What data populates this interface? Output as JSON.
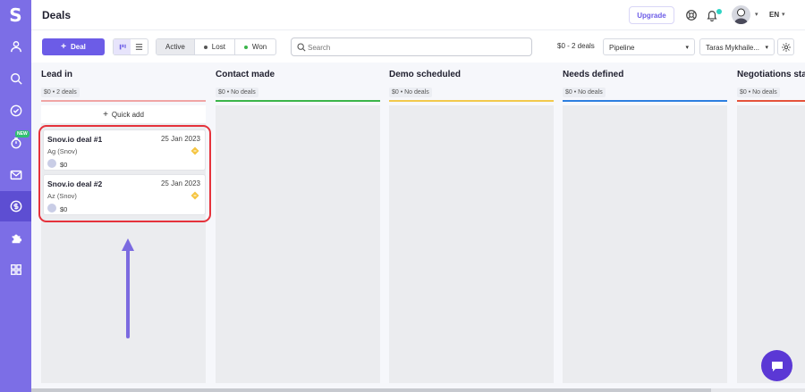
{
  "app": {
    "logo": "S",
    "page_title": "Deals"
  },
  "sidebar": {
    "items": [
      {
        "icon": "user-icon"
      },
      {
        "icon": "search-icon"
      },
      {
        "icon": "check-circle-icon"
      },
      {
        "icon": "timer-icon",
        "badge": "NEW"
      },
      {
        "icon": "mail-icon"
      },
      {
        "icon": "dollar-icon",
        "active": true
      },
      {
        "icon": "puzzle-icon"
      },
      {
        "icon": "apps-grid-icon"
      }
    ]
  },
  "header": {
    "upgrade_label": "Upgrade",
    "language": "EN"
  },
  "toolbar": {
    "add_deal_label": "Deal",
    "status_tabs": [
      {
        "label": "Active",
        "selected": true
      },
      {
        "label": "Lost",
        "color": "#555555"
      },
      {
        "label": "Won",
        "color": "#3bb54a"
      }
    ],
    "search_placeholder": "Search",
    "search_value": "",
    "summary": "$0 - 2 deals",
    "pipeline_select": "Pipeline",
    "owner_select": "Taras Mykhaile..."
  },
  "columns": [
    {
      "title": "Lead in",
      "meta": "$0 • 2 deals",
      "color": "#f0a5a5"
    },
    {
      "title": "Contact made",
      "meta": "$0 • No deals",
      "color": "#3bb54a"
    },
    {
      "title": "Demo scheduled",
      "meta": "$0 • No deals",
      "color": "#f2c94c"
    },
    {
      "title": "Needs defined",
      "meta": "$0 • No deals",
      "color": "#2d7fe0"
    },
    {
      "title": "Negotiations start",
      "meta": "$0 • No deals",
      "color": "#e5533b"
    }
  ],
  "quick_add_label": "Quick add",
  "deals": [
    {
      "title": "Snov.io deal #1",
      "date": "25 Jan 2023",
      "company": "Ag (Snov)",
      "value": "$0"
    },
    {
      "title": "Snov.io deal #2",
      "date": "25 Jan 2023",
      "company": "Az (Snov)",
      "value": "$0"
    }
  ],
  "colors": {
    "accent": "#6c5ce7",
    "sidebar": "#7c6ee6",
    "highlight": "#e5323b",
    "arrow": "#7b6ae0"
  }
}
